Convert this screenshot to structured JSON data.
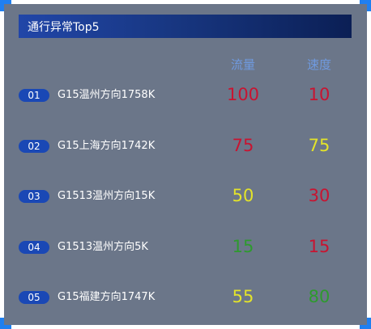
{
  "title": "通行异常Top5",
  "headers": {
    "flow": "流量",
    "speed": "速度"
  },
  "rows": [
    {
      "rank": "01",
      "name": "G15温州方向1758K",
      "flow": "100",
      "flow_level": "red",
      "speed": "10",
      "speed_level": "red"
    },
    {
      "rank": "02",
      "name": "G15上海方向1742K",
      "flow": "75",
      "flow_level": "red",
      "speed": "75",
      "speed_level": "yellow"
    },
    {
      "rank": "03",
      "name": "G1513温州方向15K",
      "flow": "50",
      "flow_level": "yellow",
      "speed": "30",
      "speed_level": "red"
    },
    {
      "rank": "04",
      "name": "G1513温州方向5K",
      "flow": "15",
      "flow_level": "green",
      "speed": "15",
      "speed_level": "red"
    },
    {
      "rank": "05",
      "name": "G15福建方向1747K",
      "flow": "55",
      "flow_level": "yellow",
      "speed": "80",
      "speed_level": "green"
    }
  ],
  "colors": {
    "red": "#c81431",
    "yellow": "#e3e32a",
    "green": "#2e9a2e",
    "badge": "#1a48b5",
    "header_text": "#6f9ae0",
    "corner_accent": "#1f7ff0"
  }
}
